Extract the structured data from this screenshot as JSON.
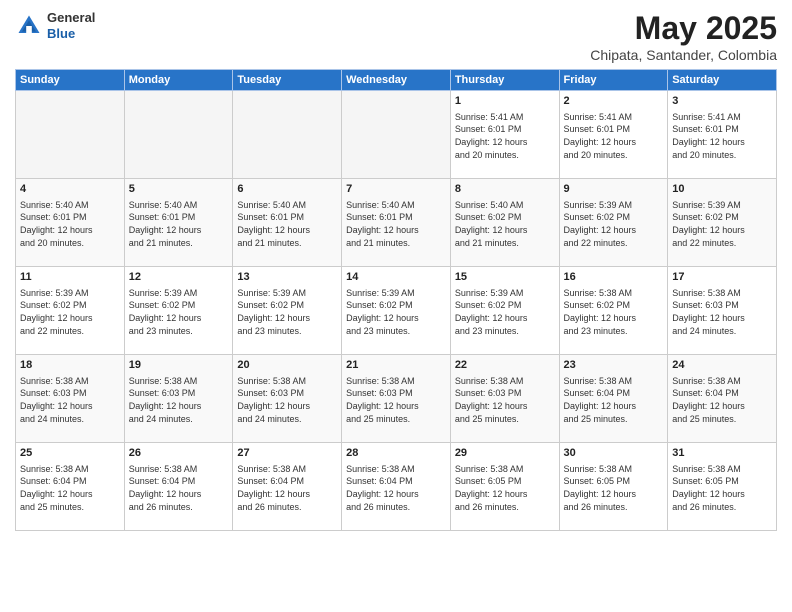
{
  "header": {
    "logo_general": "General",
    "logo_blue": "Blue",
    "month": "May 2025",
    "location": "Chipata, Santander, Colombia"
  },
  "days_of_week": [
    "Sunday",
    "Monday",
    "Tuesday",
    "Wednesday",
    "Thursday",
    "Friday",
    "Saturday"
  ],
  "weeks": [
    [
      {
        "day": "",
        "info": ""
      },
      {
        "day": "",
        "info": ""
      },
      {
        "day": "",
        "info": ""
      },
      {
        "day": "",
        "info": ""
      },
      {
        "day": "1",
        "info": "Sunrise: 5:41 AM\nSunset: 6:01 PM\nDaylight: 12 hours\nand 20 minutes."
      },
      {
        "day": "2",
        "info": "Sunrise: 5:41 AM\nSunset: 6:01 PM\nDaylight: 12 hours\nand 20 minutes."
      },
      {
        "day": "3",
        "info": "Sunrise: 5:41 AM\nSunset: 6:01 PM\nDaylight: 12 hours\nand 20 minutes."
      }
    ],
    [
      {
        "day": "4",
        "info": "Sunrise: 5:40 AM\nSunset: 6:01 PM\nDaylight: 12 hours\nand 20 minutes."
      },
      {
        "day": "5",
        "info": "Sunrise: 5:40 AM\nSunset: 6:01 PM\nDaylight: 12 hours\nand 21 minutes."
      },
      {
        "day": "6",
        "info": "Sunrise: 5:40 AM\nSunset: 6:01 PM\nDaylight: 12 hours\nand 21 minutes."
      },
      {
        "day": "7",
        "info": "Sunrise: 5:40 AM\nSunset: 6:01 PM\nDaylight: 12 hours\nand 21 minutes."
      },
      {
        "day": "8",
        "info": "Sunrise: 5:40 AM\nSunset: 6:02 PM\nDaylight: 12 hours\nand 21 minutes."
      },
      {
        "day": "9",
        "info": "Sunrise: 5:39 AM\nSunset: 6:02 PM\nDaylight: 12 hours\nand 22 minutes."
      },
      {
        "day": "10",
        "info": "Sunrise: 5:39 AM\nSunset: 6:02 PM\nDaylight: 12 hours\nand 22 minutes."
      }
    ],
    [
      {
        "day": "11",
        "info": "Sunrise: 5:39 AM\nSunset: 6:02 PM\nDaylight: 12 hours\nand 22 minutes."
      },
      {
        "day": "12",
        "info": "Sunrise: 5:39 AM\nSunset: 6:02 PM\nDaylight: 12 hours\nand 23 minutes."
      },
      {
        "day": "13",
        "info": "Sunrise: 5:39 AM\nSunset: 6:02 PM\nDaylight: 12 hours\nand 23 minutes."
      },
      {
        "day": "14",
        "info": "Sunrise: 5:39 AM\nSunset: 6:02 PM\nDaylight: 12 hours\nand 23 minutes."
      },
      {
        "day": "15",
        "info": "Sunrise: 5:39 AM\nSunset: 6:02 PM\nDaylight: 12 hours\nand 23 minutes."
      },
      {
        "day": "16",
        "info": "Sunrise: 5:38 AM\nSunset: 6:02 PM\nDaylight: 12 hours\nand 23 minutes."
      },
      {
        "day": "17",
        "info": "Sunrise: 5:38 AM\nSunset: 6:03 PM\nDaylight: 12 hours\nand 24 minutes."
      }
    ],
    [
      {
        "day": "18",
        "info": "Sunrise: 5:38 AM\nSunset: 6:03 PM\nDaylight: 12 hours\nand 24 minutes."
      },
      {
        "day": "19",
        "info": "Sunrise: 5:38 AM\nSunset: 6:03 PM\nDaylight: 12 hours\nand 24 minutes."
      },
      {
        "day": "20",
        "info": "Sunrise: 5:38 AM\nSunset: 6:03 PM\nDaylight: 12 hours\nand 24 minutes."
      },
      {
        "day": "21",
        "info": "Sunrise: 5:38 AM\nSunset: 6:03 PM\nDaylight: 12 hours\nand 25 minutes."
      },
      {
        "day": "22",
        "info": "Sunrise: 5:38 AM\nSunset: 6:03 PM\nDaylight: 12 hours\nand 25 minutes."
      },
      {
        "day": "23",
        "info": "Sunrise: 5:38 AM\nSunset: 6:04 PM\nDaylight: 12 hours\nand 25 minutes."
      },
      {
        "day": "24",
        "info": "Sunrise: 5:38 AM\nSunset: 6:04 PM\nDaylight: 12 hours\nand 25 minutes."
      }
    ],
    [
      {
        "day": "25",
        "info": "Sunrise: 5:38 AM\nSunset: 6:04 PM\nDaylight: 12 hours\nand 25 minutes."
      },
      {
        "day": "26",
        "info": "Sunrise: 5:38 AM\nSunset: 6:04 PM\nDaylight: 12 hours\nand 26 minutes."
      },
      {
        "day": "27",
        "info": "Sunrise: 5:38 AM\nSunset: 6:04 PM\nDaylight: 12 hours\nand 26 minutes."
      },
      {
        "day": "28",
        "info": "Sunrise: 5:38 AM\nSunset: 6:04 PM\nDaylight: 12 hours\nand 26 minutes."
      },
      {
        "day": "29",
        "info": "Sunrise: 5:38 AM\nSunset: 6:05 PM\nDaylight: 12 hours\nand 26 minutes."
      },
      {
        "day": "30",
        "info": "Sunrise: 5:38 AM\nSunset: 6:05 PM\nDaylight: 12 hours\nand 26 minutes."
      },
      {
        "day": "31",
        "info": "Sunrise: 5:38 AM\nSunset: 6:05 PM\nDaylight: 12 hours\nand 26 minutes."
      }
    ]
  ]
}
